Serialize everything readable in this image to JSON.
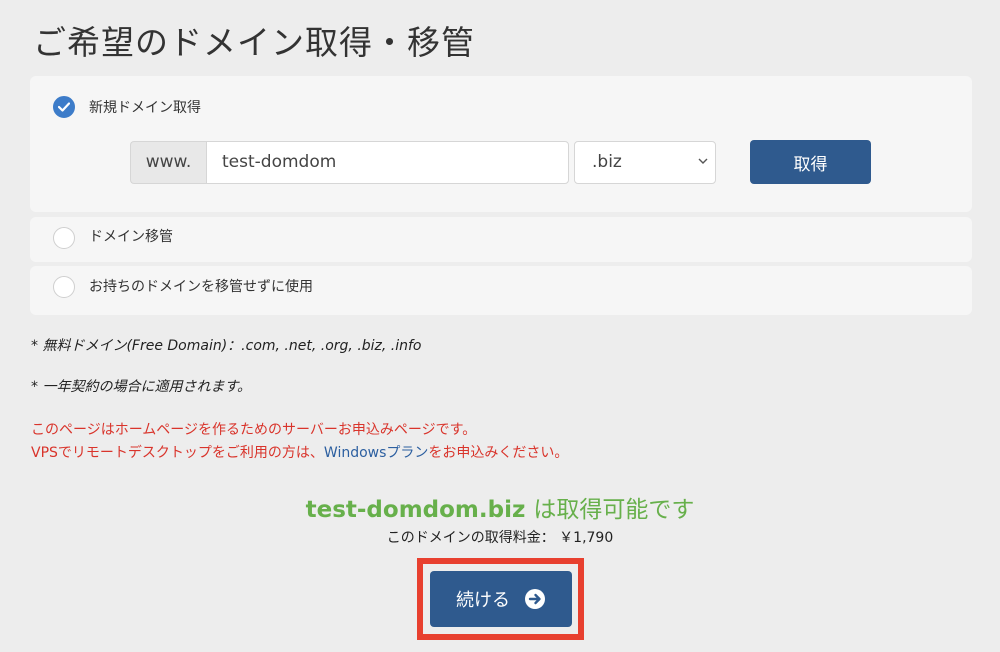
{
  "title": "ご希望のドメイン取得・移管",
  "options": {
    "new": {
      "label": "新規ドメイン取得",
      "selected": true
    },
    "transfer": {
      "label": "ドメイン移管",
      "selected": false
    },
    "existing": {
      "label": "お持ちのドメインを移管せずに使用",
      "selected": false
    }
  },
  "domain_form": {
    "prefix": "www.",
    "domain_value": "test-domdom",
    "tld_selected": ".biz",
    "get_button": "取得"
  },
  "notes": {
    "free_domain": "* 無料ドメイン(Free Domain)：.com, .net, .org, .biz, .info",
    "one_year": "* 一年契約の場合に適用されます。"
  },
  "warning": {
    "line1": "このページはホームページを作るためのサーバーお申込みページです。",
    "line2_before": "VPSでリモートデスクトップをご利用の方は、",
    "line2_link": "Windowsプラン",
    "line2_after": "をお申込みください。"
  },
  "result": {
    "domain": "test-domdom.biz",
    "status": "は取得可能です",
    "price_label": "このドメインの取得料金：",
    "price": "￥1,790"
  },
  "continue_button": "続ける",
  "colors": {
    "primary": "#2f5a8e",
    "radio_checked": "#3d7cc9",
    "available_green": "#67b04b",
    "warning_red": "#d9342b",
    "highlight_red": "#e8402f"
  }
}
